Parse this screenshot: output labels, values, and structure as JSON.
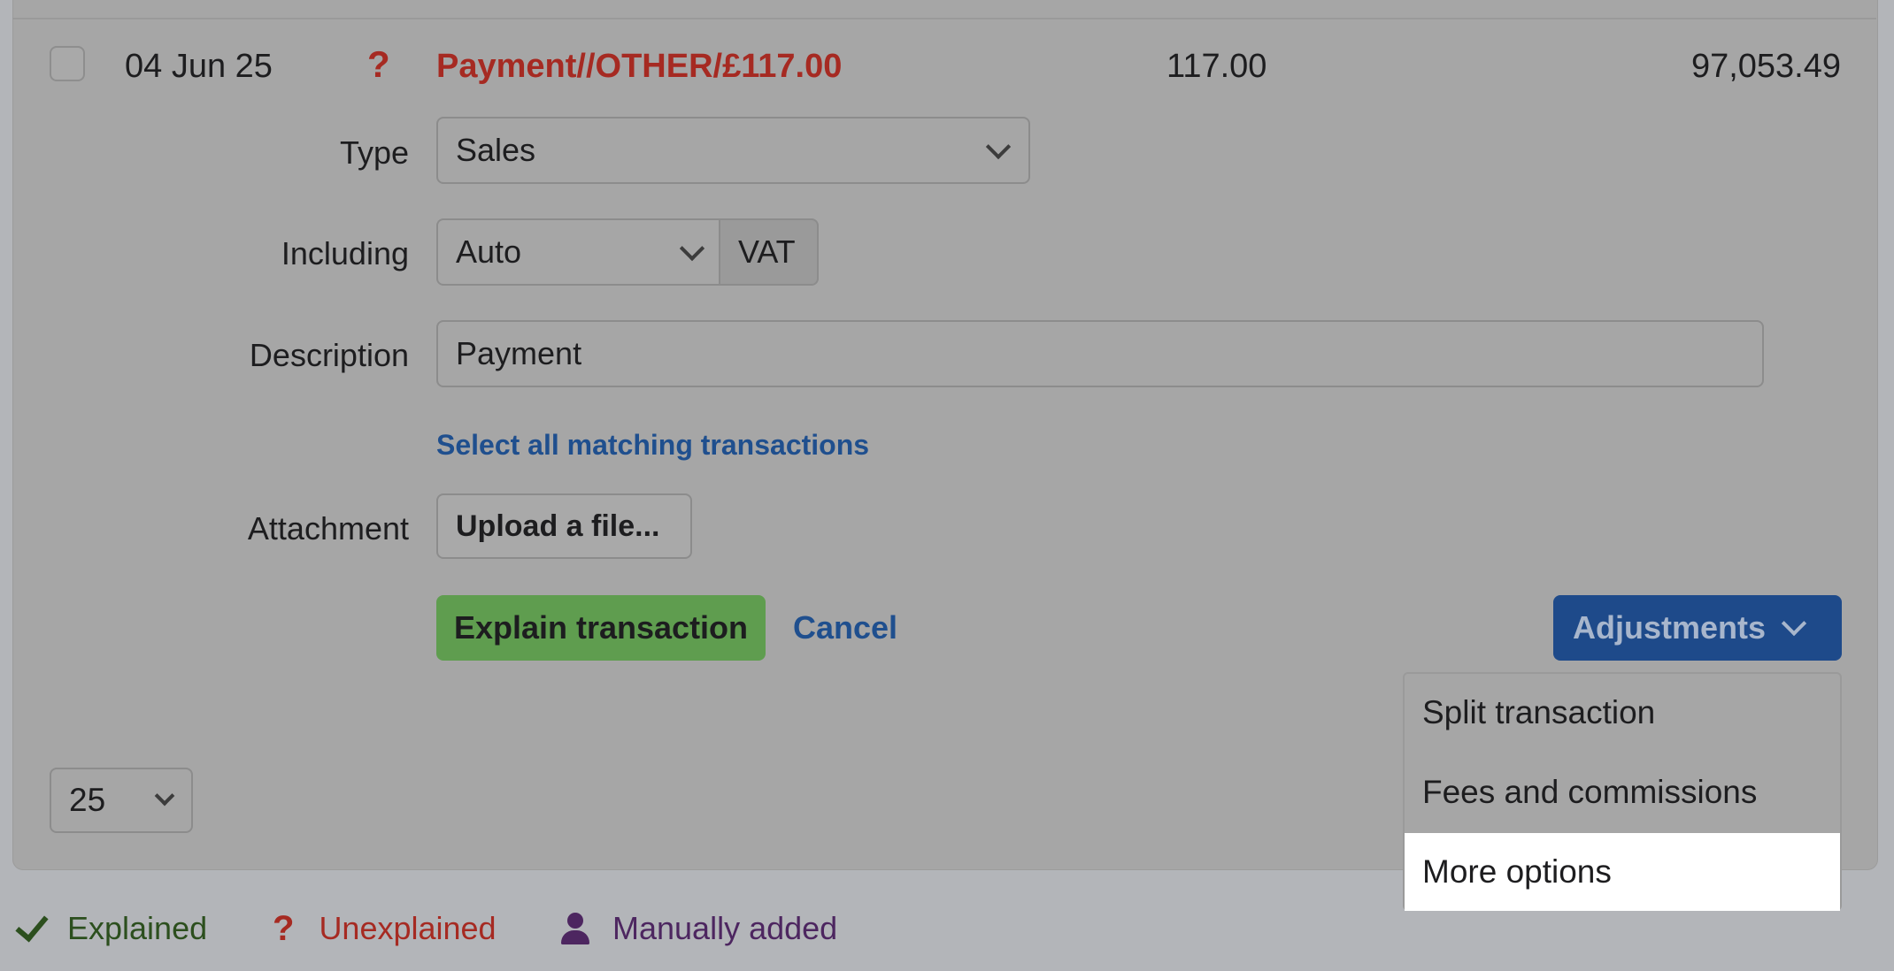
{
  "transaction": {
    "date": "04 Jun 25",
    "status_glyph": "?",
    "description": "Payment//OTHER/£117.00",
    "amount": "117.00",
    "balance": "97,053.49"
  },
  "form": {
    "type_label": "Type",
    "type_value": "Sales",
    "including_label": "Including",
    "including_value": "Auto",
    "vat_addon": "VAT",
    "description_label": "Description",
    "description_value": "Payment",
    "select_matching_link": "Select all matching transactions",
    "attachment_label": "Attachment",
    "upload_button": "Upload a file...",
    "explain_button": "Explain transaction",
    "cancel_link": "Cancel"
  },
  "adjustments": {
    "button_label": "Adjustments",
    "menu_items": [
      "Split transaction",
      "Fees and commissions",
      "More options"
    ],
    "highlighted_item": "More options"
  },
  "pagination": {
    "page_size": "25"
  },
  "legend": {
    "explained": "Explained",
    "unexplained_glyph": "?",
    "unexplained": "Unexplained",
    "manually_added": "Manually added"
  },
  "colors": {
    "unexplained_red": "#a62a22",
    "link_blue": "#1f4f8e",
    "explain_green": "#5f9d4f",
    "adjust_blue": "#1e4a8a",
    "explained_green": "#2c4f1e",
    "manual_purple": "#4d2660"
  },
  "icons": [
    "check-icon",
    "question-mark-icon",
    "person-icon",
    "chevron-down-icon"
  ]
}
